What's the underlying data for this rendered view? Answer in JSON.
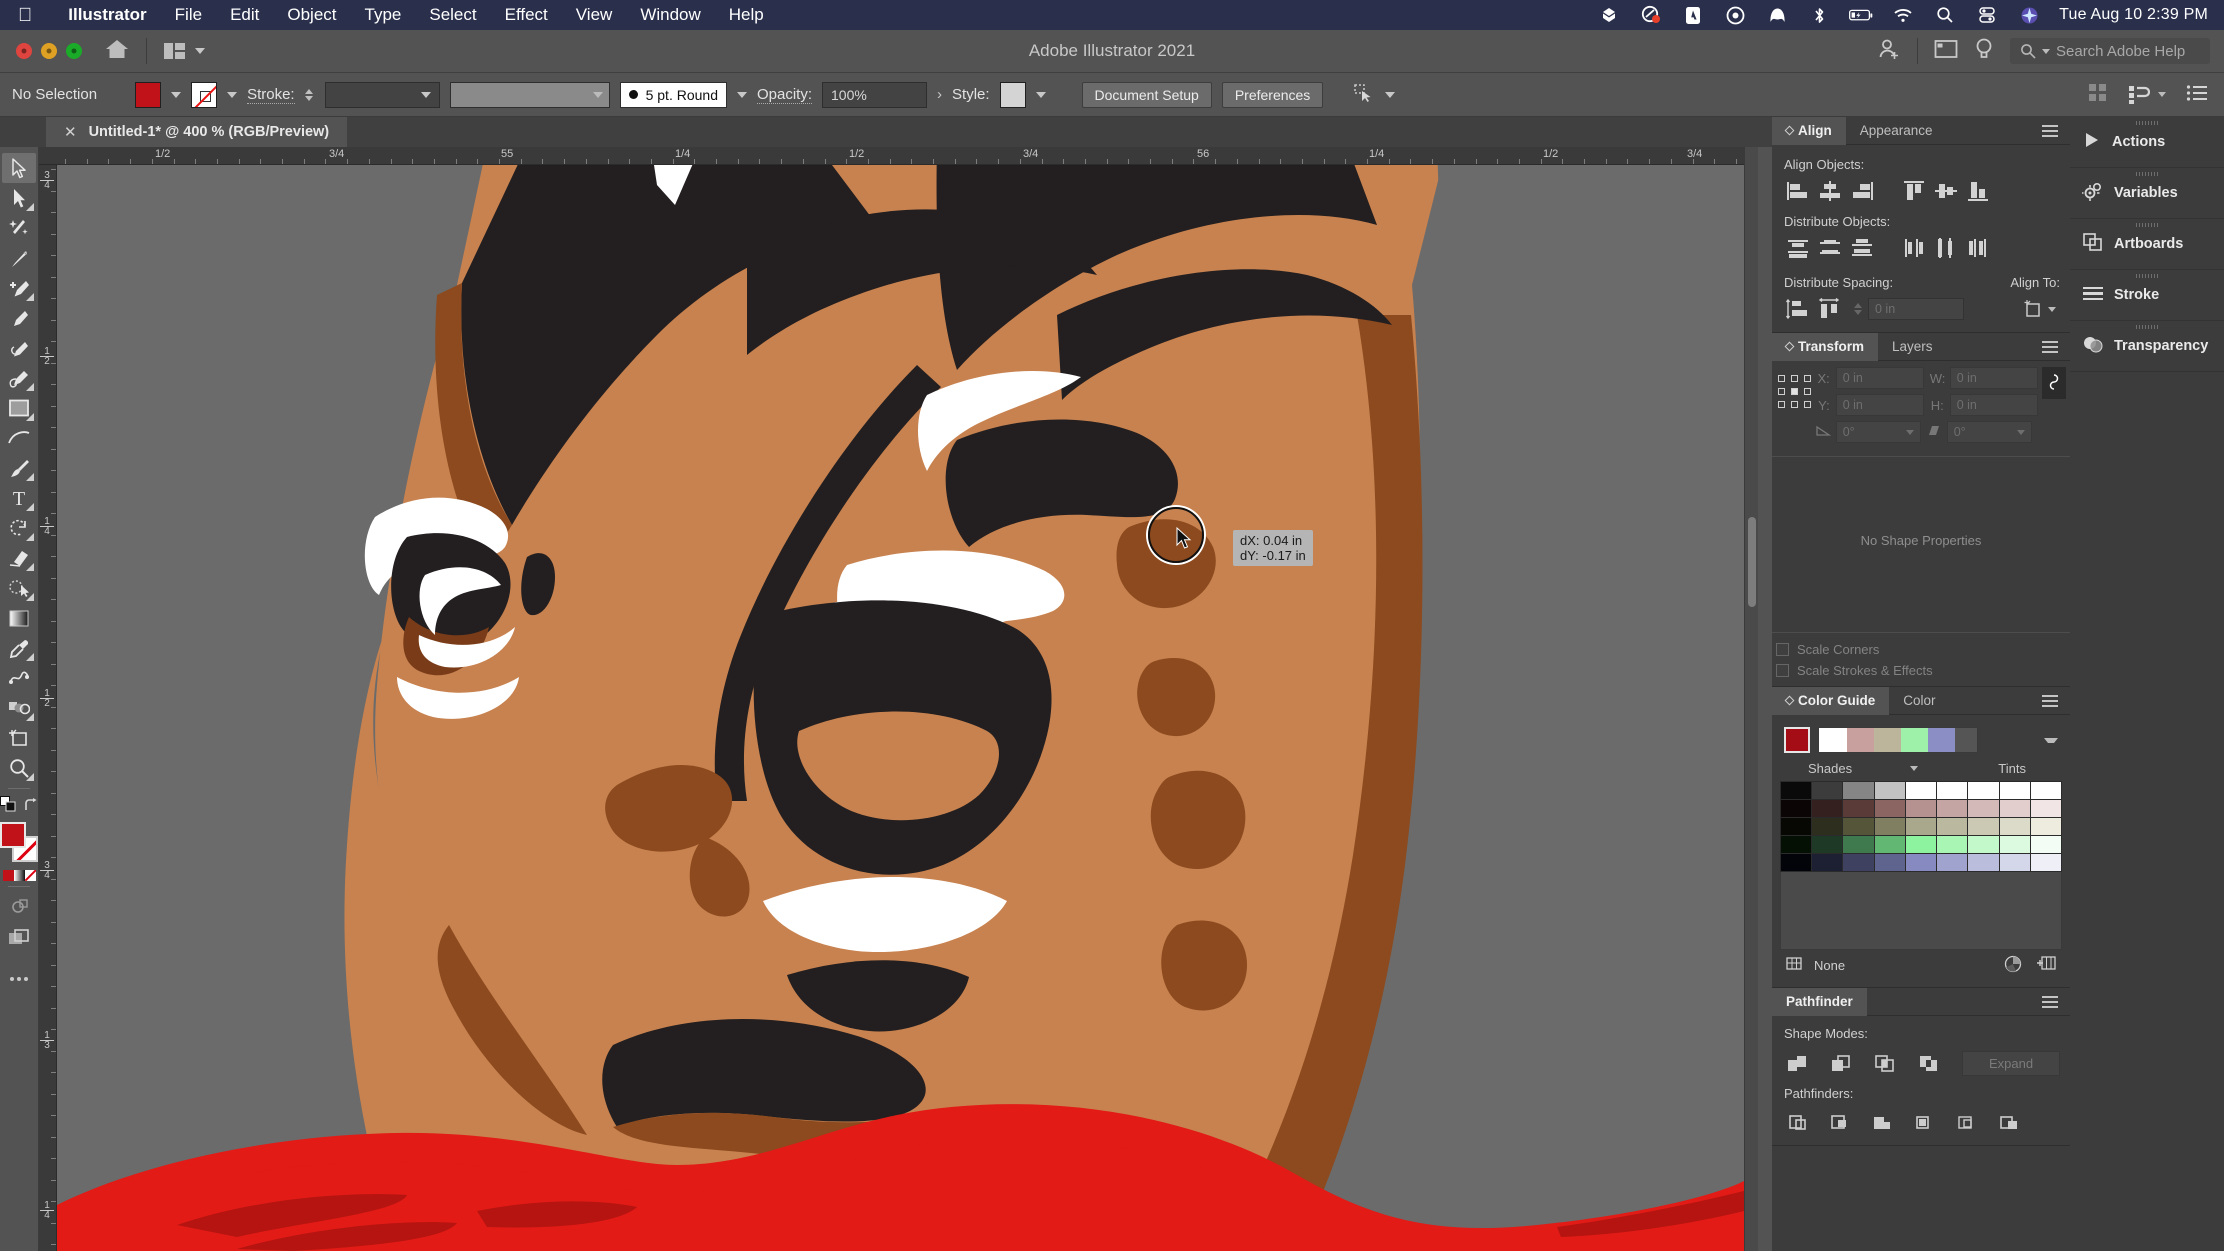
{
  "macbar": {
    "apple_icon": "apple-logo-icon",
    "menus": [
      {
        "label": "Illustrator",
        "bold": true
      },
      {
        "label": "File",
        "bold": false
      },
      {
        "label": "Edit",
        "bold": false
      },
      {
        "label": "Object",
        "bold": false
      },
      {
        "label": "Type",
        "bold": false
      },
      {
        "label": "Select",
        "bold": false
      },
      {
        "label": "Effect",
        "bold": false
      },
      {
        "label": "View",
        "bold": false
      },
      {
        "label": "Window",
        "bold": false
      },
      {
        "label": "Help",
        "bold": false
      }
    ],
    "status_icons": [
      "dropbox-icon",
      "cleanmymac-icon",
      "adobe-creative-cloud-icon",
      "onedrive-icon",
      "malwarebytes-icon",
      "bluetooth-icon",
      "battery-charging-icon",
      "wifi-icon",
      "spotlight-search-icon",
      "control-center-icon",
      "siri-icon"
    ],
    "clock": "Tue Aug 10  2:39 PM"
  },
  "titlebar": {
    "app_title": "Adobe Illustrator 2021",
    "home_icon": "home-icon",
    "arrange_documents_icon": "arrange-documents-icon",
    "account_icon": "account-add-icon",
    "workspace_icon": "workspace-switcher-icon",
    "discover_icon": "discover-bulb-icon",
    "search_placeholder": "Search Adobe Help",
    "search_icon": "search-icon"
  },
  "controlbar": {
    "selection_status": "No Selection",
    "fill_color": "#c1121a",
    "stroke_color": "none",
    "stroke_label": "Stroke:",
    "stroke_weight": "",
    "stroke_profile": "uniform",
    "brush_definition": "5 pt. Round",
    "opacity_label": "Opacity:",
    "opacity_value": "100%",
    "style_label": "Style:",
    "style_swatch": "#d4d4d4",
    "document_setup_button": "Document Setup",
    "preferences_button": "Preferences",
    "select_similar_icon": "select-similar-objects-icon",
    "align_icon": "align-grid-icon",
    "distribute_icon": "distribute-icon",
    "options_menu_icon": "panel-options-icon"
  },
  "doctab": {
    "close_icon": "close-tab-icon",
    "title": "Untitled-1* @ 400 % (RGB/Preview)"
  },
  "toolbar": {
    "tools": [
      {
        "name": "selection-tool",
        "active": true
      },
      {
        "name": "direct-selection-tool",
        "active": false
      },
      {
        "name": "magic-wand-tool",
        "active": false
      },
      {
        "name": "lasso-tool",
        "active": false
      },
      {
        "name": "pen-tool",
        "active": false
      },
      {
        "name": "add-anchor-point-tool",
        "active": false
      },
      {
        "name": "curvature-tool",
        "active": false
      },
      {
        "name": "type-tool-alt",
        "active": false
      },
      {
        "name": "rectangle-tool",
        "active": false
      },
      {
        "name": "line-segment-tool",
        "active": false
      },
      {
        "name": "paintbrush-tool",
        "active": false
      },
      {
        "name": "type-tool",
        "active": false
      },
      {
        "name": "rotate-tool",
        "active": false
      },
      {
        "name": "eraser-tool",
        "active": false
      },
      {
        "name": "shape-builder-tool",
        "active": false
      },
      {
        "name": "gradient-tool",
        "active": false
      },
      {
        "name": "eyedropper-tool",
        "active": false
      },
      {
        "name": "blend-tool",
        "active": false
      },
      {
        "name": "symbol-sprayer-tool",
        "active": false
      },
      {
        "name": "artboard-tool",
        "active": false
      },
      {
        "name": "zoom-tool",
        "active": false
      }
    ],
    "fill_color": "#c1121a",
    "stroke_color": "none",
    "screen_mode_icon": "screen-mode-icon",
    "edit_toolbar_icon": "edit-toolbar-ellipsis-icon"
  },
  "rulers": {
    "unit": "in",
    "horizontal_labels": [
      "1/2",
      "3/4",
      "55",
      "1/4",
      "1/2",
      "3/4",
      "56",
      "1/4",
      "1/2",
      "3/4"
    ],
    "vertical_labels": [
      "3/4",
      "1/2",
      "1/4",
      "1/2",
      "3/4",
      "1/3",
      "1/4"
    ]
  },
  "canvas": {
    "background": "#6b6b6b",
    "artwork_colors": {
      "skin": "#c8824f",
      "skin_shadow": "#8c4a1e",
      "hair_black": "#231f20",
      "white": "#ffffff",
      "shirt_red": "#e21b16",
      "shirt_red_dark": "#b51410"
    },
    "cursor": {
      "type": "brush-circle-cursor",
      "tooltip_dx": "dX: 0.04 in",
      "tooltip_dy": "dY: -0.17 in"
    }
  },
  "align_panel": {
    "tabs": [
      {
        "label": "Align",
        "active": true
      },
      {
        "label": "Appearance",
        "active": false
      }
    ],
    "align_objects_label": "Align Objects:",
    "align_buttons": [
      "align-left-icon",
      "align-horizontal-center-icon",
      "align-right-icon",
      "align-top-icon",
      "align-vertical-center-icon",
      "align-bottom-icon"
    ],
    "distribute_objects_label": "Distribute Objects:",
    "distribute_buttons": [
      "distribute-vertical-top-icon",
      "distribute-vertical-center-icon",
      "distribute-vertical-bottom-icon",
      "distribute-horizontal-left-icon",
      "distribute-horizontal-center-icon",
      "distribute-horizontal-right-icon"
    ],
    "distribute_spacing_label": "Distribute Spacing:",
    "spacing_buttons": [
      "distribute-vertical-space-icon",
      "distribute-horizontal-space-icon"
    ],
    "spacing_value": "0 in",
    "align_to_label": "Align To:",
    "align_to_icon": "align-to-artboard-icon"
  },
  "transform_panel": {
    "tabs": [
      {
        "label": "Transform",
        "active": true
      },
      {
        "label": "Layers",
        "active": false
      }
    ],
    "reference_point_icon": "reference-point-grid-icon",
    "fields": [
      {
        "label": "X:",
        "value": "0 in"
      },
      {
        "label": "W:",
        "value": "0 in"
      },
      {
        "label": "Y:",
        "value": "0 in"
      },
      {
        "label": "H:",
        "value": "0 in"
      }
    ],
    "rotate_label_icon": "rotate-angle-icon",
    "rotate_value": "0°",
    "shear_label_icon": "shear-angle-icon",
    "shear_value": "0°",
    "link_icon": "constrain-proportions-link-icon",
    "no_shape_properties": "No Shape Properties",
    "scale_corners": "Scale Corners",
    "scale_strokes": "Scale Strokes & Effects"
  },
  "colorguide_panel": {
    "tabs": [
      {
        "label": "Color Guide",
        "active": true
      },
      {
        "label": "Color",
        "active": false
      }
    ],
    "base_color": "#a40d15",
    "harmony_colors": [
      "#ffffff",
      "#c8a19e",
      "#bcb49b",
      "#9df1a9",
      "#8a8ec4"
    ],
    "shades_label": "Shades",
    "tints_label": "Tints",
    "grid_rows": [
      [
        "#0a0a0a",
        "#3c3c3c",
        "#858585",
        "#c2c2c2",
        "#ffffff",
        "#ffffff",
        "#ffffff",
        "#ffffff",
        "#ffffff"
      ],
      [
        "#0c0505",
        "#34201f",
        "#5b3b38",
        "#8a6562",
        "#b59290",
        "#c4a5a3",
        "#d3b9b7",
        "#e2cecd",
        "#f1e6e5"
      ],
      [
        "#070704",
        "#2e2e1f",
        "#55553a",
        "#807f62",
        "#a9a78c",
        "#bab89f",
        "#cbc9b4",
        "#dcdbc9",
        "#edecdf"
      ],
      [
        "#041004",
        "#1e3a26",
        "#3f7a4e",
        "#62b873",
        "#8ef39e",
        "#a8f5b4",
        "#c2f8ca",
        "#dbfae0",
        "#f3fdf5"
      ],
      [
        "#03030a",
        "#1d1f33",
        "#3e4260",
        "#5f648f",
        "#868ac0",
        "#a0a3ce",
        "#babddc",
        "#d4d6ea",
        "#eeeff7"
      ]
    ],
    "footer_label": "None",
    "limit_colors_icon": "limit-colors-icon",
    "edit_colors_icon": "edit-colors-icon",
    "save_group_icon": "save-color-group-icon"
  },
  "pathfinder_panel": {
    "tabs": [
      {
        "label": "Pathfinder",
        "active": true
      }
    ],
    "shape_modes_label": "Shape Modes:",
    "shape_modes": [
      "unite-icon",
      "minus-front-icon",
      "intersect-icon",
      "exclude-icon"
    ],
    "expand_button": "Expand",
    "pathfinders_label": "Pathfinders:",
    "pathfinders": [
      "divide-icon",
      "trim-icon",
      "merge-icon",
      "crop-icon",
      "outline-icon",
      "minus-back-icon"
    ]
  },
  "icondock": {
    "items": [
      {
        "label": "Actions",
        "icon": "actions-play-icon"
      },
      {
        "label": "Variables",
        "icon": "variables-gears-icon"
      },
      {
        "label": "Artboards",
        "icon": "artboards-icon"
      },
      {
        "label": "Stroke",
        "icon": "stroke-lines-icon"
      },
      {
        "label": "Transparency",
        "icon": "transparency-circles-icon"
      }
    ]
  }
}
